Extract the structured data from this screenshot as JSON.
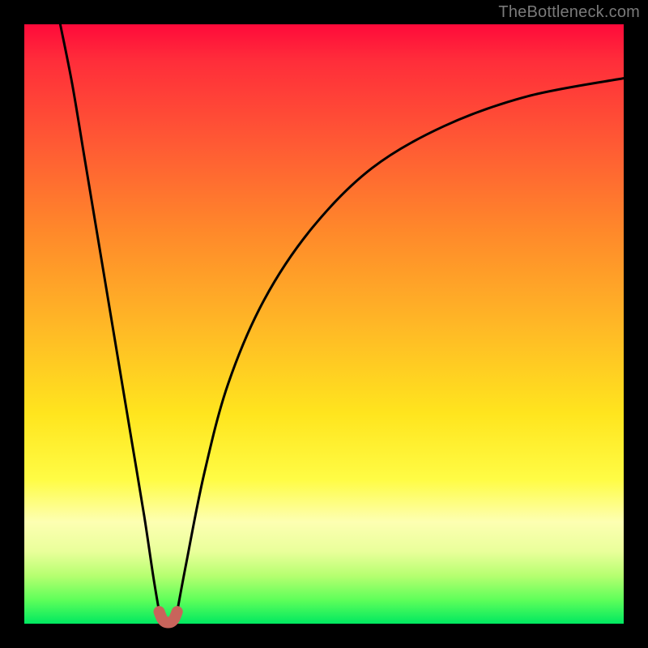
{
  "watermark": "TheBottleneck.com",
  "chart_data": {
    "type": "line",
    "title": "",
    "xlabel": "",
    "ylabel": "",
    "xlim": [
      0,
      100
    ],
    "ylim": [
      0,
      100
    ],
    "grid": false,
    "legend": false,
    "comment": "Piecewise curve in plot-area percent coordinates (0–100). Two branches that meet at a rounded pink minimum.",
    "series": [
      {
        "name": "left-branch",
        "color": "#000000",
        "x": [
          6,
          8,
          10,
          12,
          14,
          16,
          18,
          20,
          21.5,
          22.5
        ],
        "y": [
          100,
          90,
          78,
          66,
          54,
          42,
          30,
          18,
          8,
          2
        ]
      },
      {
        "name": "right-branch",
        "color": "#000000",
        "x": [
          25.5,
          27,
          30,
          34,
          40,
          48,
          58,
          70,
          84,
          100
        ],
        "y": [
          2,
          10,
          25,
          40,
          54,
          66,
          76,
          83,
          88,
          91
        ]
      },
      {
        "name": "minimum-arc",
        "color": "#c8645b",
        "x": [
          22.5,
          23,
          23.5,
          24,
          24.5,
          25,
          25.5
        ],
        "y": [
          2,
          0.8,
          0.3,
          0.2,
          0.3,
          0.8,
          2
        ]
      }
    ],
    "minimum": {
      "x": 24,
      "y": 0.2
    }
  },
  "colors": {
    "frame": "#000000",
    "curve": "#000000",
    "minimum_stroke": "#c8645b",
    "watermark": "#7a7a7a"
  }
}
